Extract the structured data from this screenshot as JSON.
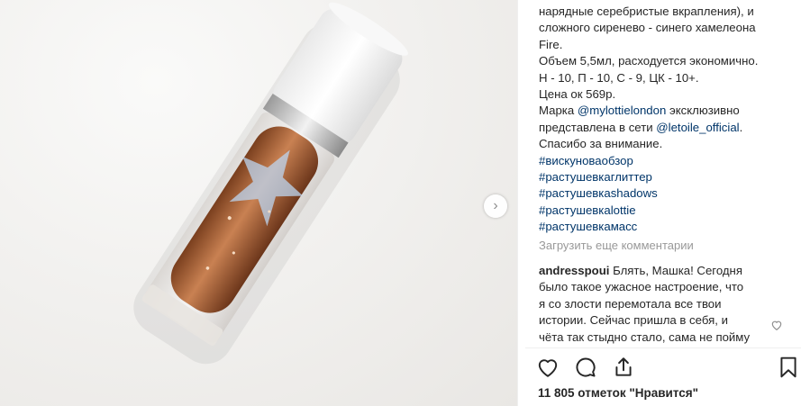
{
  "post": {
    "caption_lines": [
      "нарядные серебристые вкрапления), и",
      "сложного сиренево - синего хамелеона",
      "Fire.",
      "Объем 5,5мл, расходуется экономично.",
      "Н - 10, П - 10, С - 9, ЦК - 10+.",
      "Цена ок 569р."
    ],
    "brand_prefix": "Марка ",
    "brand_mention": "@mylottielondon",
    "brand_suffix": " эксклюзивно",
    "network_prefix": "представлена в сети ",
    "network_mention": "@letoile_official",
    "network_suffix": ".",
    "thanks": "Спасибо за внимание.",
    "hashtags": [
      "#вискуноваобзор",
      "#растушевкаглиттер",
      "#растушевкаshadows",
      "#растушевкаlottie",
      "#растушевкамасс"
    ]
  },
  "load_more_label": "Загрузить еще комментарии",
  "comment": {
    "username": "andresspoui",
    "first_line_text": " Блять, Машка! Сегодня",
    "lines": [
      "было такое ужасное настроение, что",
      "я со злости перемотала все твои",
      "истории. Сейчас пришла в себя, и",
      "чёта так стыдно стало, сама не пойму"
    ]
  },
  "actions": {
    "like_icon": "heart-icon",
    "comment_icon": "comment-bubble-icon",
    "share_icon": "share-icon",
    "save_icon": "bookmark-icon"
  },
  "likes_text": "11 805 отметок \"Нравится\"",
  "carousel_next_glyph": "›",
  "colors": {
    "text": "#262626",
    "link": "#003569",
    "muted": "#999999"
  }
}
